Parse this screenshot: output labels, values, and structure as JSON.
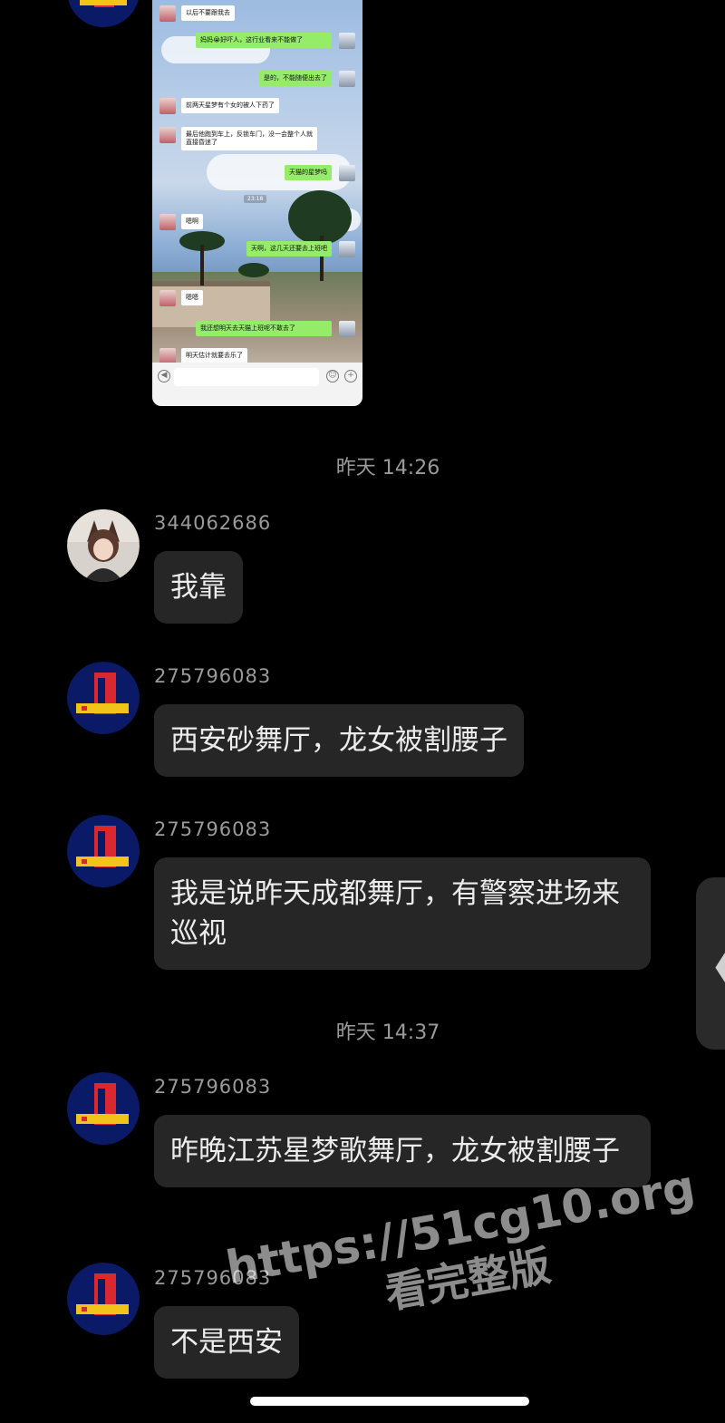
{
  "embedded_chat": {
    "messages": [
      {
        "dir": "in",
        "text": "以后不要跟我去"
      },
      {
        "dir": "out",
        "text": "妈妈😭好吓人，这行业看来不能做了"
      },
      {
        "dir": "out",
        "text": "是的，不能随便出去了"
      },
      {
        "dir": "in",
        "text": "前两天星梦有个女的被人下药了"
      },
      {
        "dir": "in",
        "text": "最后他跑到车上，反锁车门，没一会整个人就直接昏迷了"
      },
      {
        "dir": "out",
        "text": "天猫的星梦吗"
      },
      {
        "dir": "in",
        "text": "嗯啊"
      },
      {
        "dir": "out",
        "text": "天啊，这几天还要去上班吧"
      },
      {
        "dir": "in",
        "text": "嗯嗯"
      },
      {
        "dir": "out",
        "text": "我还想明天去天猫上班呢不敢去了"
      },
      {
        "dir": "in",
        "text": "明天估计就要去乐了"
      }
    ],
    "time_divider": "23:18"
  },
  "timestamps": [
    "昨天 14:26",
    "昨天 14:37"
  ],
  "messages": [
    {
      "sender": "344062686",
      "text": "我靠",
      "avatar": "anime-girl-avatar"
    },
    {
      "sender": "275796083",
      "text": "西安砂舞厅，龙女被割腰子",
      "avatar": "retro-logo-avatar"
    },
    {
      "sender": "275796083",
      "text": "我是说昨天成都舞厅，有警察进场来巡视",
      "avatar": "retro-logo-avatar"
    },
    {
      "sender": "275796083",
      "text": "昨晚江苏星梦歌舞厅，龙女被割腰子",
      "avatar": "retro-logo-avatar"
    },
    {
      "sender": "275796083",
      "text": "不是西安",
      "avatar": "retro-logo-avatar"
    }
  ],
  "edge_tab": {
    "icon": "chevron-left-icon",
    "glyph": "❮"
  },
  "watermark": {
    "line1": "https://51cg10.org",
    "line2": "看完整版"
  },
  "colors": {
    "background": "#000000",
    "bubble": "#262626",
    "meta_text": "#9a9a9a"
  }
}
